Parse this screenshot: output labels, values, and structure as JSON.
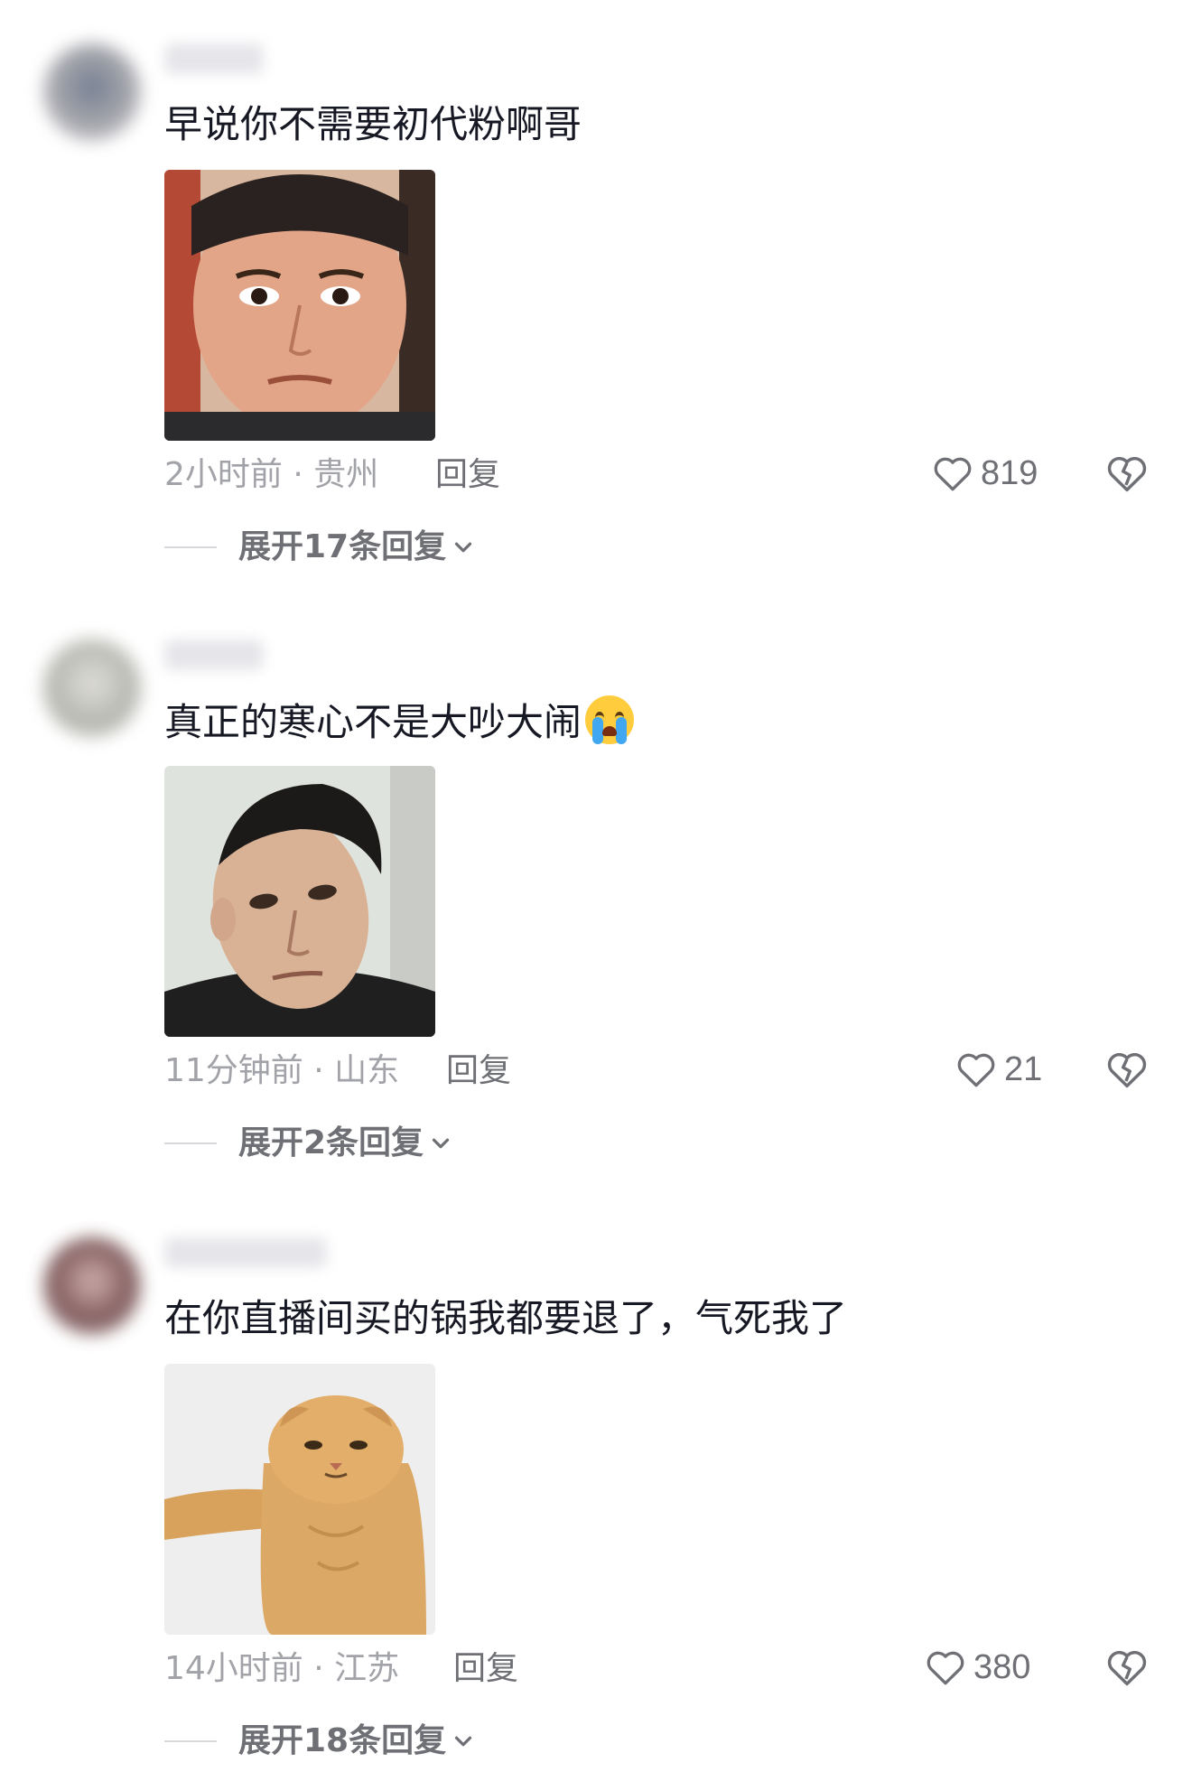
{
  "comments": [
    {
      "text": "早说你不需要初代粉啊哥",
      "meta": "2小时前 · 贵州",
      "reply_label": "回复",
      "likes": "819",
      "expand_label": "展开17条回复",
      "avatar_color": "#8a8a90",
      "meme": "man-staring-face"
    },
    {
      "text": "真正的寒心不是大吵大闹",
      "emoji": "loudly-crying-face",
      "meta": "11分钟前 · 山东",
      "reply_label": "回复",
      "likes": "21",
      "expand_label": "展开2条回复",
      "avatar_color": "#b9b9b4",
      "meme": "man-tilted-head"
    },
    {
      "text": "在你直播间买的锅我都要退了，气死我了",
      "meta": "14小时前 · 江苏",
      "reply_label": "回复",
      "likes": "380",
      "expand_label": "展开18条回复",
      "avatar_color": "#7a4c4c",
      "meme": "orange-cat-pointing"
    }
  ],
  "colors": {
    "text": "#161823",
    "meta": "#a2a3a8",
    "action": "#6f7075",
    "divider": "#d8d9dc"
  },
  "icons": [
    "heart-outline-icon",
    "broken-heart-icon",
    "chevron-down-icon",
    "loudly-crying-face-emoji"
  ]
}
